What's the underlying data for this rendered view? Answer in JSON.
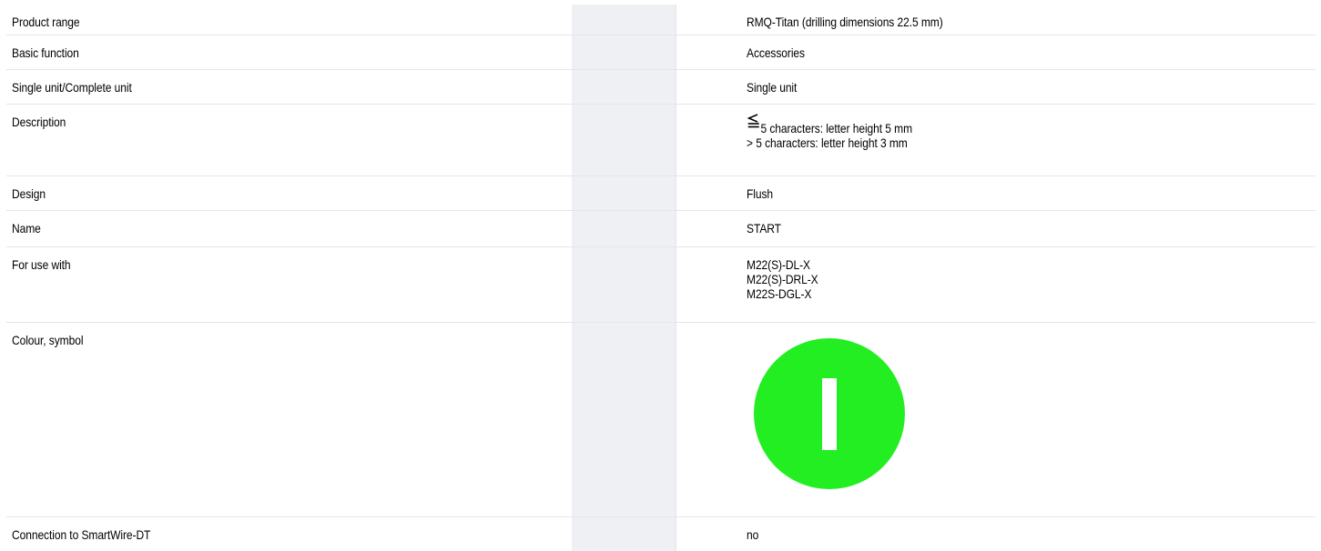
{
  "rows": [
    {
      "label": "Product range",
      "value": "RMQ-Titan (drilling dimensions 22.5 mm)"
    },
    {
      "label": "Basic function",
      "value": "Accessories"
    },
    {
      "label": "Single unit/Complete unit",
      "value": "Single unit"
    },
    {
      "label": "Description",
      "lines": [
        "5 characters: letter height 5 mm",
        "> 5 characters: letter height 3 mm"
      ],
      "icon": "less-than-or-equal-icon"
    },
    {
      "label": "Design",
      "value": "Flush"
    },
    {
      "label": "Name",
      "value": "START"
    },
    {
      "label": "For use with",
      "lines": [
        "M22(S)-DL-X",
        "M22(S)-DRL-X",
        "M22S-DGL-X"
      ]
    },
    {
      "label": "Colour, symbol",
      "symbol": {
        "icon": "green-start-i-symbol-icon",
        "color": "#22ee22",
        "mark_color": "#ffffff"
      }
    },
    {
      "label": "Connection to SmartWire-DT",
      "value": "no"
    }
  ]
}
